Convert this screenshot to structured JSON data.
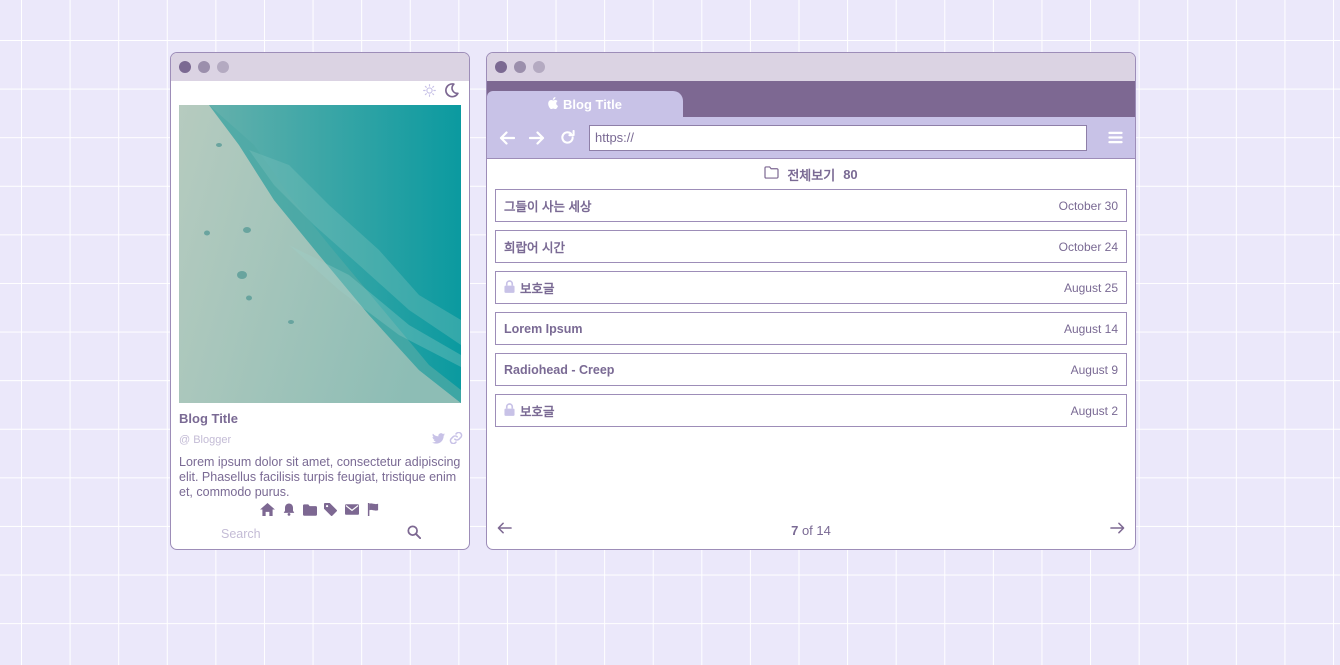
{
  "colors": {
    "background": "#ebe8fa",
    "accent": "#7d6892",
    "tab_light": "#c8c2e7",
    "text": "#7a6a94",
    "muted": "#c4bcd6"
  },
  "profile": {
    "theme_icons": [
      "sun-icon",
      "moon-icon"
    ],
    "blog_title": "Blog Title",
    "blogger": "@ Blogger",
    "social_icons": [
      "twitter-icon",
      "link-icon"
    ],
    "description": "Lorem ipsum dolor sit amet, consectetur adipiscing elit. Phasellus facilisis turpis feugiat, tristique enim et, commodo purus.",
    "menu_icons": [
      "home-icon",
      "bell-icon",
      "folder-icon",
      "tag-icon",
      "envelope-icon",
      "flag-icon"
    ],
    "search": {
      "placeholder": "Search",
      "value": ""
    }
  },
  "browser": {
    "tab": {
      "label": "Blog Title",
      "icon": "apple-icon"
    },
    "url": "https://",
    "category": {
      "label": "전체보기",
      "count": "80",
      "icon": "folder-outline-icon"
    },
    "posts": [
      {
        "title": "그들이 사는 세상",
        "date": "October 30",
        "locked": false
      },
      {
        "title": "희랍어 시간",
        "date": "October 24",
        "locked": false
      },
      {
        "title": "보호글",
        "date": "August 25",
        "locked": true
      },
      {
        "title": "Lorem Ipsum",
        "date": "August 14",
        "locked": false
      },
      {
        "title": "Radiohead - Creep",
        "date": "August 9",
        "locked": false
      },
      {
        "title": "보호글",
        "date": "August 2",
        "locked": true
      }
    ],
    "pager": {
      "current": "7",
      "of_label": "of",
      "total": "14"
    }
  }
}
